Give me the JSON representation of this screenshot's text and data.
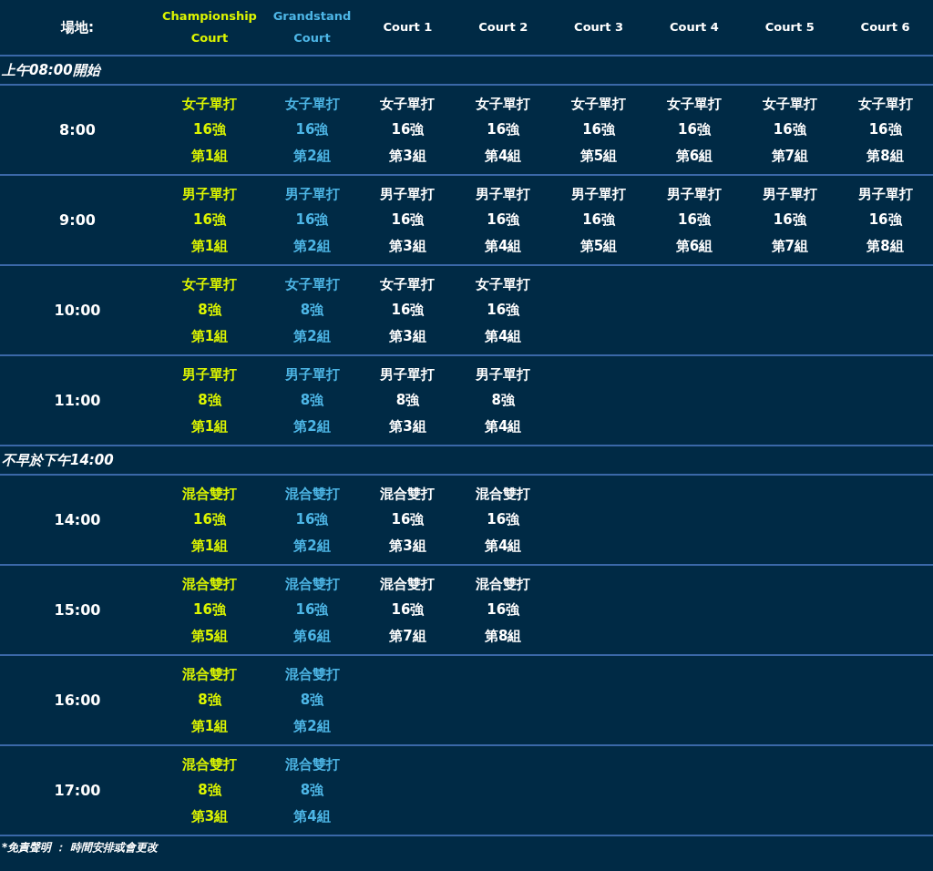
{
  "venue_label": "場地:",
  "columns": [
    {
      "name": "Championship Court",
      "color": "#dcf500"
    },
    {
      "name": "Grandstand Court",
      "color": "#4db6e6"
    },
    {
      "name": "Court 1",
      "color": "#ffffff"
    },
    {
      "name": "Court 2",
      "color": "#ffffff"
    },
    {
      "name": "Court 3",
      "color": "#ffffff"
    },
    {
      "name": "Court 4",
      "color": "#ffffff"
    },
    {
      "name": "Court 5",
      "color": "#ffffff"
    },
    {
      "name": "Court 6",
      "color": "#ffffff"
    }
  ],
  "sections": [
    {
      "heading": "上午08:00開始",
      "rows": [
        {
          "time": "8:00",
          "cells": [
            [
              "女子單打",
              "16強",
              "第1組"
            ],
            [
              "女子單打",
              "16強",
              "第2組"
            ],
            [
              "女子單打",
              "16強",
              "第3組"
            ],
            [
              "女子單打",
              "16強",
              "第4組"
            ],
            [
              "女子單打",
              "16強",
              "第5組"
            ],
            [
              "女子單打",
              "16強",
              "第6組"
            ],
            [
              "女子單打",
              "16強",
              "第7組"
            ],
            [
              "女子單打",
              "16強",
              "第8組"
            ]
          ]
        },
        {
          "time": "9:00",
          "cells": [
            [
              "男子單打",
              "16強",
              "第1組"
            ],
            [
              "男子單打",
              "16強",
              "第2組"
            ],
            [
              "男子單打",
              "16強",
              "第3組"
            ],
            [
              "男子單打",
              "16強",
              "第4組"
            ],
            [
              "男子單打",
              "16強",
              "第5組"
            ],
            [
              "男子單打",
              "16強",
              "第6組"
            ],
            [
              "男子單打",
              "16強",
              "第7組"
            ],
            [
              "男子單打",
              "16強",
              "第8組"
            ]
          ]
        },
        {
          "time": "10:00",
          "cells": [
            [
              "女子單打",
              "8強",
              "第1組"
            ],
            [
              "女子單打",
              "8強",
              "第2組"
            ],
            [
              "女子單打",
              "16強",
              "第3組"
            ],
            [
              "女子單打",
              "16強",
              "第4組"
            ]
          ]
        },
        {
          "time": "11:00",
          "cells": [
            [
              "男子單打",
              "8強",
              "第1組"
            ],
            [
              "男子單打",
              "8強",
              "第2組"
            ],
            [
              "男子單打",
              "8強",
              "第3組"
            ],
            [
              "男子單打",
              "8強",
              "第4組"
            ]
          ]
        }
      ]
    },
    {
      "heading": "不早於下午14:00",
      "rows": [
        {
          "time": "14:00",
          "cells": [
            [
              "混合雙打",
              "16強",
              "第1組"
            ],
            [
              "混合雙打",
              "16強",
              "第2組"
            ],
            [
              "混合雙打",
              "16強",
              "第3組"
            ],
            [
              "混合雙打",
              "16強",
              "第4組"
            ]
          ]
        },
        {
          "time": "15:00",
          "cells": [
            [
              "混合雙打",
              "16強",
              "第5組"
            ],
            [
              "混合雙打",
              "16強",
              "第6組"
            ],
            [
              "混合雙打",
              "16強",
              "第7組"
            ],
            [
              "混合雙打",
              "16強",
              "第8組"
            ]
          ]
        },
        {
          "time": "16:00",
          "cells": [
            [
              "混合雙打",
              "8強",
              "第1組"
            ],
            [
              "混合雙打",
              "8強",
              "第2組"
            ]
          ]
        },
        {
          "time": "17:00",
          "cells": [
            [
              "混合雙打",
              "8強",
              "第3組"
            ],
            [
              "混合雙打",
              "8強",
              "第4組"
            ]
          ]
        }
      ]
    }
  ],
  "disclaimer": "*免責聲明 ： 時間安排或會更改"
}
